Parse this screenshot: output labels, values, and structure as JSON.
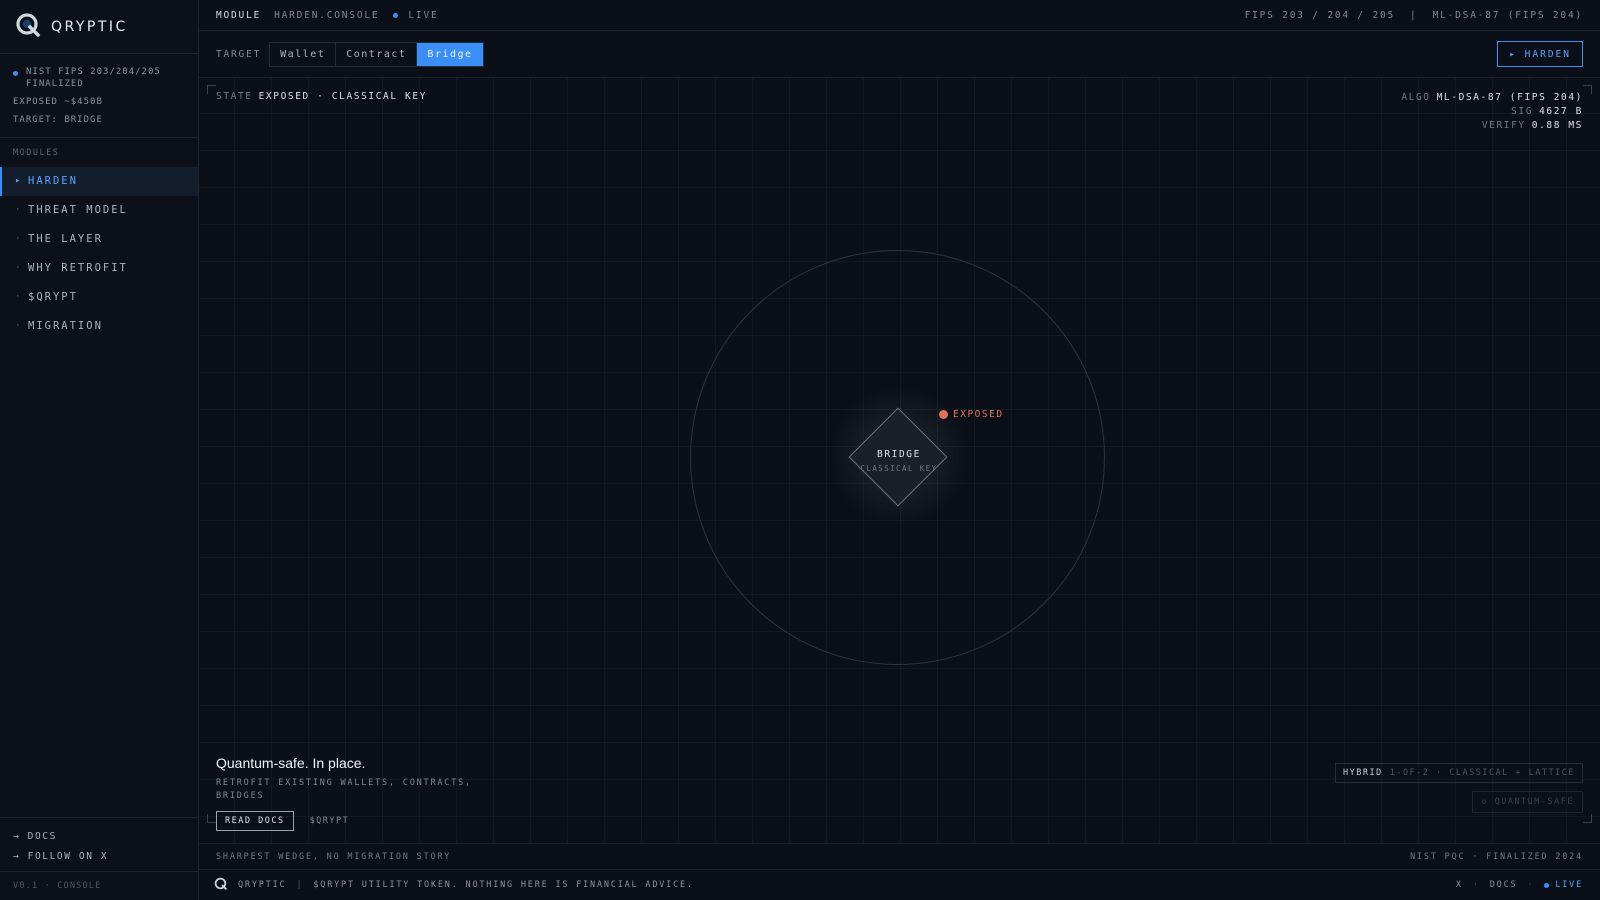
{
  "brand": {
    "name": "QRYPTIC",
    "icon": "q-logo-icon"
  },
  "sidebar": {
    "status_lines": [
      "NIST FIPS 203/204/205 FINALIZED",
      "EXPOSED ~$450B",
      "TARGET: BRIDGE"
    ],
    "modules_label": "MODULES",
    "items": [
      {
        "label": "HARDEN",
        "active": true
      },
      {
        "label": "THREAT MODEL",
        "active": false
      },
      {
        "label": "THE LAYER",
        "active": false
      },
      {
        "label": "WHY RETROFIT",
        "active": false
      },
      {
        "label": "$QRYPT",
        "active": false
      },
      {
        "label": "MIGRATION",
        "active": false
      }
    ],
    "links": [
      "→ DOCS",
      "→ FOLLOW ON X"
    ],
    "version": "V0.1 · CONSOLE"
  },
  "topbar": {
    "module_label": "MODULE",
    "module_value": "HARDEN.CONSOLE",
    "live": "LIVE",
    "right": "FIPS 203 / 204 / 205  |  ML-DSA-87 (FIPS 204)"
  },
  "target": {
    "label": "TARGET",
    "options": [
      "Wallet",
      "Contract",
      "Bridge"
    ],
    "selected": "Bridge",
    "harden_button": "▸ HARDEN"
  },
  "stage": {
    "state_label": "STATE",
    "state_value": "EXPOSED · CLASSICAL KEY",
    "algo": [
      {
        "k": "ALGO",
        "v": "ML-DSA-87 (FIPS 204)"
      },
      {
        "k": "SIG",
        "v": "4627 B"
      },
      {
        "k": "VERIFY",
        "v": "0.88 MS"
      }
    ],
    "node_title": "BRIDGE",
    "node_sub": "CLASSICAL KEY",
    "exposed_tag": "EXPOSED",
    "hero_title": "Quantum-safe. In place.",
    "hero_sub": "RETROFIT EXISTING WALLETS, CONTRACTS, BRIDGES",
    "read_docs": "READ DOCS",
    "token_link": "$QRYPT",
    "hybrid_key": "HYBRID",
    "hybrid_value": "1-OF-2 · CLASSICAL + LATTICE",
    "quantum_safe": "◇ QUANTUM-SAFE"
  },
  "footline": {
    "left": "SHARPEST WEDGE, NO MIGRATION STORY",
    "right": "NIST PQC · FINALIZED 2024"
  },
  "bottombar": {
    "name": "QRYPTIC",
    "disclaimer": "$QRYPT UTILITY TOKEN. NOTHING HERE IS FINANCIAL ADVICE.",
    "link_x": "X",
    "link_docs": "DOCS",
    "link_live": "LIVE"
  },
  "colors": {
    "accent": "#3a8ef6",
    "exposed": "#e0715a",
    "background": "#0b0f17"
  }
}
